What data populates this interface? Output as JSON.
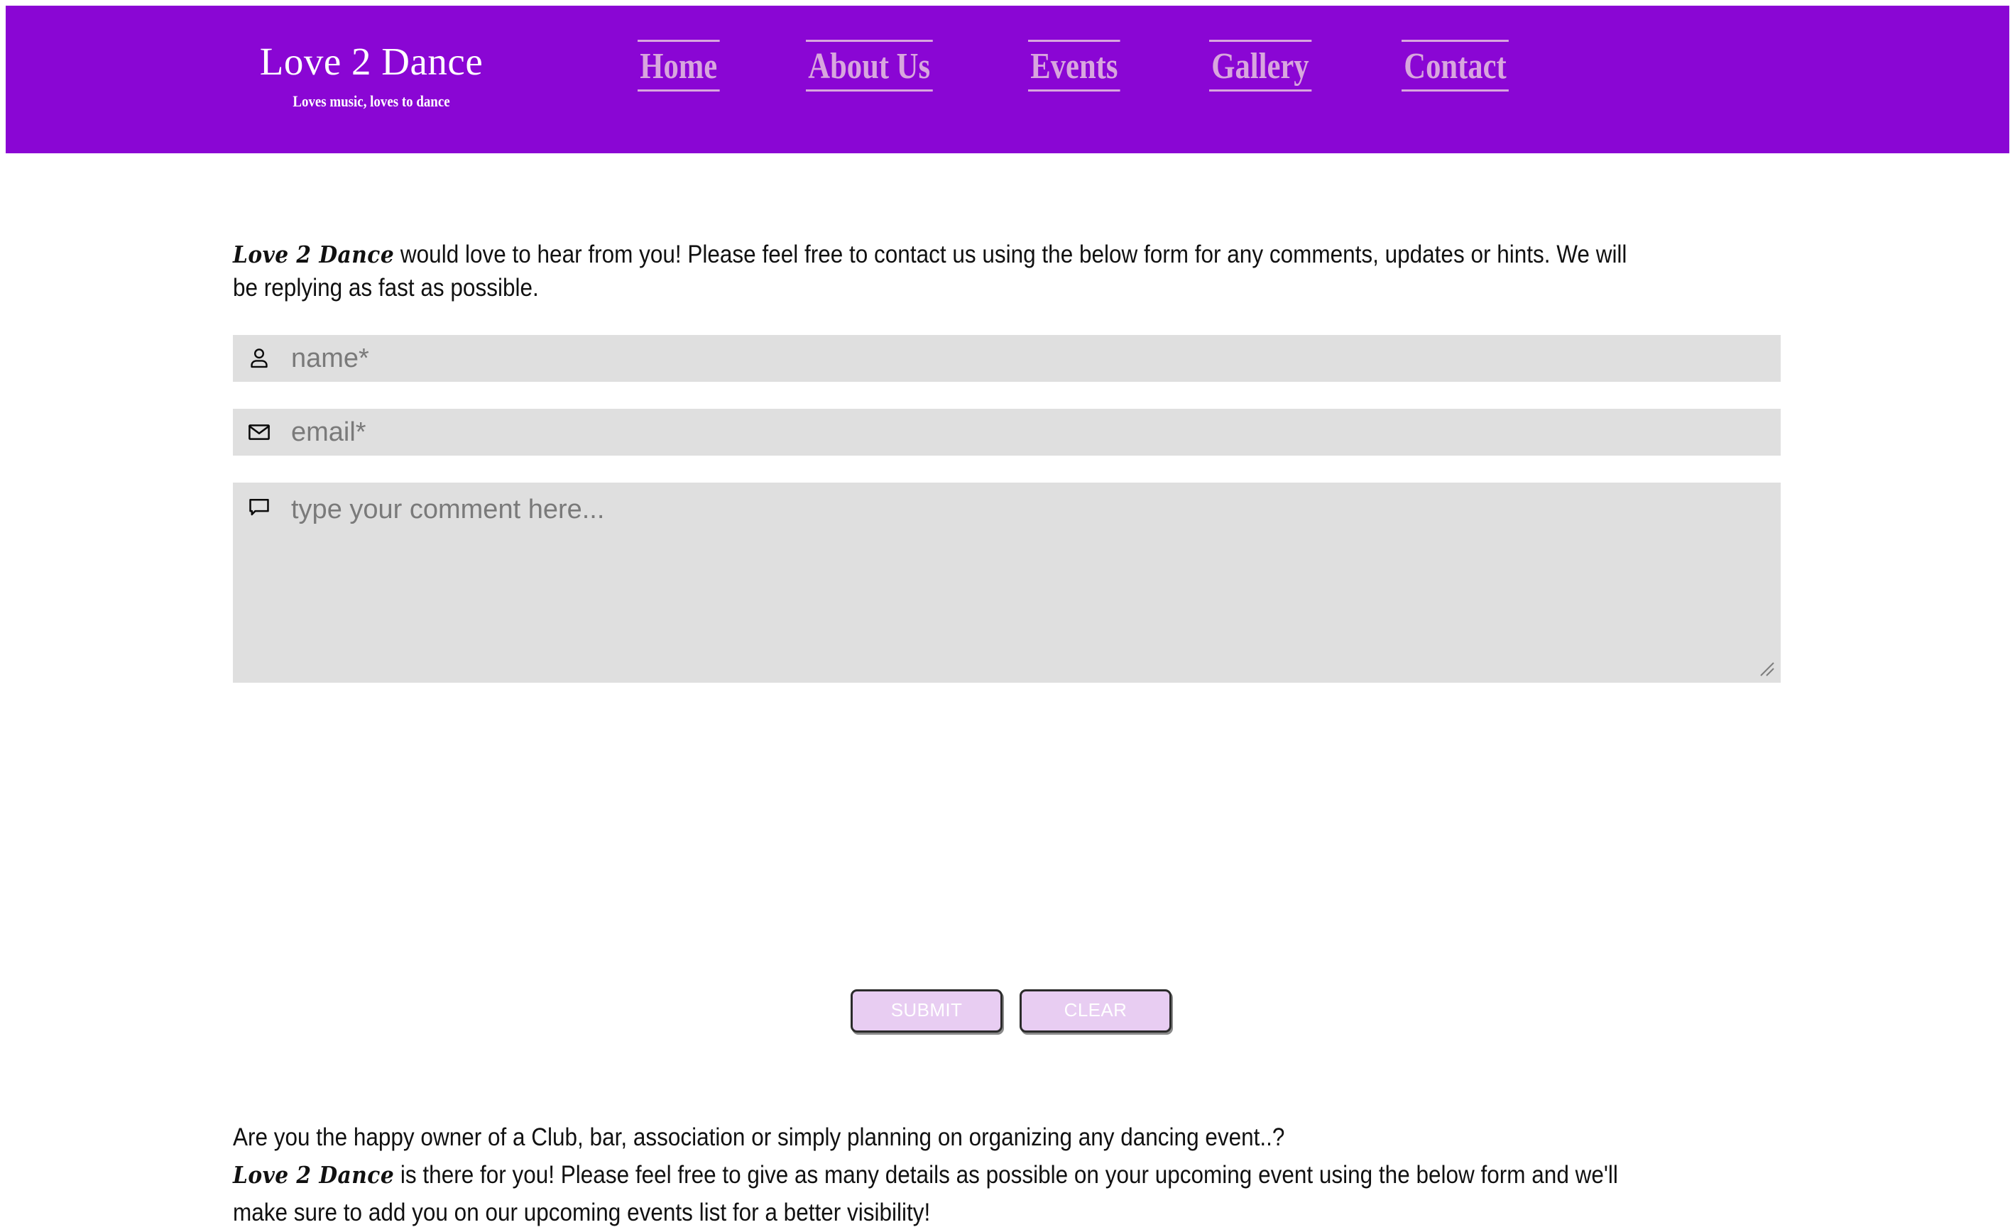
{
  "colors": {
    "header_bg": "#8A06D4",
    "nav_link": "#D8A6DE",
    "brand_text": "#ffffff",
    "field_bg": "#DFDFDF",
    "placeholder": "#7a7a7a",
    "button_bg": "#E8CDF2",
    "button_border": "#2b2b2b",
    "body_text": "#111111",
    "page_bg": "#ffffff"
  },
  "header": {
    "brand_title": "Love 2 Dance",
    "brand_tagline": "Loves music, loves to dance",
    "nav": [
      {
        "label": "Home",
        "name": "nav-item-home"
      },
      {
        "label": "About Us",
        "name": "nav-item-about-us"
      },
      {
        "label": "Events",
        "name": "nav-item-events"
      },
      {
        "label": "Gallery",
        "name": "nav-item-gallery"
      },
      {
        "label": "Contact",
        "name": "nav-item-contact"
      }
    ]
  },
  "intro": {
    "brand": "Love 2 Dance",
    "text": " would love to hear from you! Please feel free to contact us using the below form for any comments, updates or hints. We will be replying as fast as possible."
  },
  "form": {
    "name_field": {
      "placeholder": "name*",
      "value": "",
      "icon": "person-icon"
    },
    "email_field": {
      "placeholder": "email*",
      "value": "",
      "icon": "envelope-icon"
    },
    "comment_field": {
      "placeholder": "type your comment here...",
      "value": "",
      "icon": "speech-bubble-icon"
    },
    "submit_label": "SUBMIT",
    "clear_label": "CLEAR"
  },
  "outro": {
    "line1": "Are you the happy owner of a Club, bar, association or simply planning on organizing any dancing event..?",
    "brand": "Love 2 Dance",
    "line2": " is there for you! Please feel free to give as many details as possible on your upcoming event using the below form and we'll make sure to add you on our upcoming events list for a better visibility!"
  }
}
